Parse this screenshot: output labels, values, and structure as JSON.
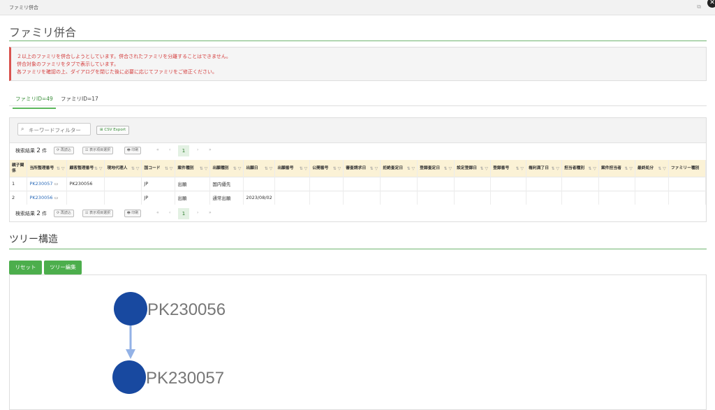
{
  "window": {
    "title": "ファミリ併合"
  },
  "page": {
    "title": "ファミリ併合"
  },
  "alert": {
    "lines": [
      "２以上のファミリを併合しようとしています。併合されたファミリを分離することはできません。",
      "併合対象のファミリをタブで表示しています。",
      "各ファミリを確認の上、ダイアログを閉じた後に必要に応じてファミリをご修正ください。"
    ]
  },
  "tabs": [
    {
      "label": "ファミリID=49",
      "active": true
    },
    {
      "label": "ファミリID=17",
      "active": false
    }
  ],
  "toolbar": {
    "search_placeholder": "キーワードフィルター",
    "search_icon": "search-icon",
    "csv_label": "CSV Export"
  },
  "pager": {
    "count_prefix": "検索結果",
    "count_value": "2",
    "count_suffix": "件",
    "reload_label": "⟳ 再読込",
    "columns_label": "☷ 表示項目選択",
    "print_label": "🖶 印刷",
    "first": "«",
    "prev": "‹",
    "page": "1",
    "next": "›",
    "last": "»"
  },
  "table": {
    "sort_filter_glyph": "⇅ ▽",
    "columns": [
      "親子関係",
      "当所整理番号",
      "顧客整理番号",
      "現地代理人",
      "国コード",
      "案件種別",
      "出願種別",
      "出願日",
      "出願番号",
      "公開番号",
      "審査請求日",
      "拒絶査定日",
      "登録査定日",
      "設定登録日",
      "登録番号",
      "権利満了日",
      "担当者種別",
      "案件担当者",
      "最終処分",
      "ファミリー種別"
    ],
    "rows": [
      {
        "no": "1",
        "ref": "PK230057",
        "customer": "PK230056",
        "country": "JP",
        "case_type": "出願",
        "app_type": "国内優先",
        "app_date": ""
      },
      {
        "no": "2",
        "ref": "PK230056",
        "customer": "",
        "country": "JP",
        "case_type": "出願",
        "app_type": "通常出願",
        "app_date": "2023/08/02"
      }
    ]
  },
  "tree": {
    "section_title": "ツリー構造",
    "reset_label": "リセット",
    "edit_label": "ツリー編集",
    "nodes": [
      {
        "label": "PK230056",
        "parent": null
      },
      {
        "label": "PK230057",
        "parent": "PK230056"
      }
    ],
    "node_color": "#1849a0",
    "edge_color": "#93b2e6"
  }
}
